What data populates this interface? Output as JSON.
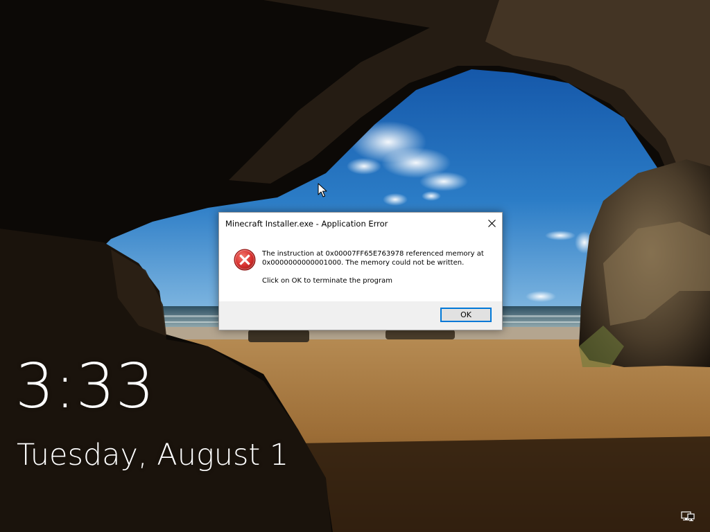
{
  "lock_screen": {
    "time": "3:33",
    "date": "Tuesday, August 1"
  },
  "dialog": {
    "title": "Minecraft Installer.exe - Application Error",
    "message_line1": "The instruction at 0x00007FF65E763978 referenced memory at",
    "message_line2": "0x0000000000001000. The memory could not be written.",
    "message_hint": "Click on OK to terminate the program",
    "ok_label": "OK"
  },
  "icons": {
    "close": "close-icon",
    "error": "error-icon",
    "network": "network-icon",
    "cursor": "mouse-pointer-icon"
  },
  "colors": {
    "accent": "#0078d7",
    "error_red": "#d9312f",
    "footer_bg": "#f0f0f0"
  }
}
